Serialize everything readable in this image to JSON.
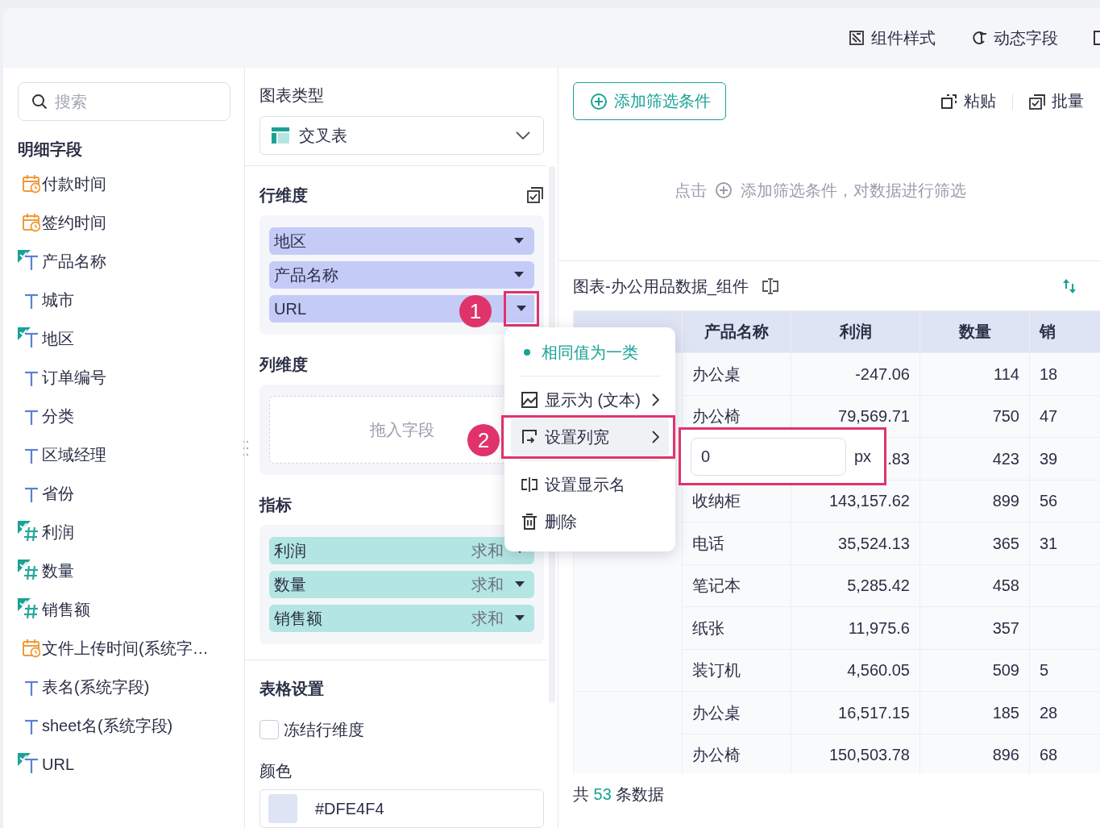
{
  "top_bar": {
    "items": [
      {
        "label": "组件样式"
      },
      {
        "label": "动态字段"
      }
    ]
  },
  "fields_panel": {
    "search": {
      "placeholder": "搜索"
    },
    "title": "明细字段",
    "fields": [
      {
        "name": "付款时间",
        "kind": "date",
        "checked": false
      },
      {
        "name": "签约时间",
        "kind": "date",
        "checked": false
      },
      {
        "name": "产品名称",
        "kind": "text",
        "checked": true
      },
      {
        "name": "城市",
        "kind": "text",
        "checked": false
      },
      {
        "name": "地区",
        "kind": "text",
        "checked": true
      },
      {
        "name": "订单编号",
        "kind": "text",
        "checked": false
      },
      {
        "name": "分类",
        "kind": "text",
        "checked": false
      },
      {
        "name": "区域经理",
        "kind": "text",
        "checked": false
      },
      {
        "name": "省份",
        "kind": "text",
        "checked": false
      },
      {
        "name": "利润",
        "kind": "number",
        "checked": true
      },
      {
        "name": "数量",
        "kind": "number",
        "checked": true
      },
      {
        "name": "销售额",
        "kind": "number",
        "checked": true
      },
      {
        "name": "文件上传时间(系统字…",
        "kind": "date",
        "checked": false
      },
      {
        "name": "表名(系统字段)",
        "kind": "text",
        "checked": false
      },
      {
        "name": "sheet名(系统字段)",
        "kind": "text",
        "checked": false
      },
      {
        "name": "URL",
        "kind": "text",
        "checked": true
      }
    ]
  },
  "config_panel": {
    "chart_type_label": "图表类型",
    "chart_type": "交叉表",
    "row_dimension": {
      "title": "行维度",
      "items": [
        {
          "name": "地区",
          "highlighted": false
        },
        {
          "name": "产品名称",
          "highlighted": false
        },
        {
          "name": "URL",
          "highlighted": true
        }
      ]
    },
    "column_dimension": {
      "title": "列维度",
      "placeholder": "拖入字段"
    },
    "metrics": {
      "title": "指标",
      "items": [
        {
          "name": "利润",
          "aggregation": "求和"
        },
        {
          "name": "数量",
          "aggregation": "求和"
        },
        {
          "name": "销售额",
          "aggregation": "求和"
        }
      ]
    },
    "table_settings": {
      "title": "表格设置",
      "freeze_row_dimension": {
        "label": "冻结行维度",
        "checked": false
      },
      "color_label": "颜色",
      "color": "#DFE4F4"
    }
  },
  "data_panel": {
    "add_filter_button": "添加筛选条件",
    "toolbar": [
      {
        "label": "粘贴"
      },
      {
        "label": "批量"
      }
    ],
    "filter_hint": {
      "before": "点击",
      "after": "添加筛选条件，对数据进行筛选"
    },
    "table_title": "图表-办公用品数据_组件",
    "table": {
      "columns": [
        "产品名称",
        "利润",
        "数量",
        "销"
      ],
      "groups": [
        {
          "rows": [
            {
              "product": "办公桌",
              "profit": "-247.06",
              "quantity": "114",
              "sales": "18"
            },
            {
              "product": "办公椅",
              "profit": "79,569.71",
              "quantity": "750",
              "sales": "47"
            },
            {
              "profit": ".83",
              "quantity": "423",
              "sales": "39"
            },
            {
              "product": "收纳柜",
              "profit": "143,157.62",
              "quantity": "899",
              "sales": "56"
            },
            {
              "product": "电话",
              "profit": "35,524.13",
              "quantity": "365",
              "sales": "31"
            },
            {
              "product": "笔记本",
              "profit": "5,285.42",
              "quantity": "458"
            },
            {
              "product": "纸张",
              "profit": "11,975.6",
              "quantity": "357"
            },
            {
              "product": "装订机",
              "profit": "4,560.05",
              "quantity": "509",
              "sales": "5"
            }
          ]
        },
        {
          "rows": [
            {
              "product": "办公桌",
              "profit": "16,517.15",
              "quantity": "185",
              "sales": "28"
            },
            {
              "product": "办公椅",
              "profit": "150,503.78",
              "quantity": "896",
              "sales": "68"
            }
          ]
        }
      ]
    },
    "footer": {
      "before": "共",
      "count": "53",
      "after": "条数据"
    }
  },
  "context_menu": {
    "items": [
      {
        "label": "相同值为一类",
        "kind": "option",
        "selected": true,
        "highlighted": false
      },
      {
        "label": "显示为 (文本)",
        "kind": "submenu",
        "selected": false,
        "highlighted": false
      },
      {
        "label": "设置列宽",
        "kind": "submenu",
        "selected": false,
        "highlighted": true
      },
      {
        "label": "设置显示名",
        "kind": "action",
        "selected": false,
        "highlighted": false
      },
      {
        "label": "删除",
        "kind": "action",
        "selected": false,
        "highlighted": false
      }
    ],
    "width_popup": {
      "value": "0",
      "unit": "px"
    }
  },
  "step_badges": [
    {
      "label": "1"
    },
    {
      "label": "2"
    }
  ]
}
